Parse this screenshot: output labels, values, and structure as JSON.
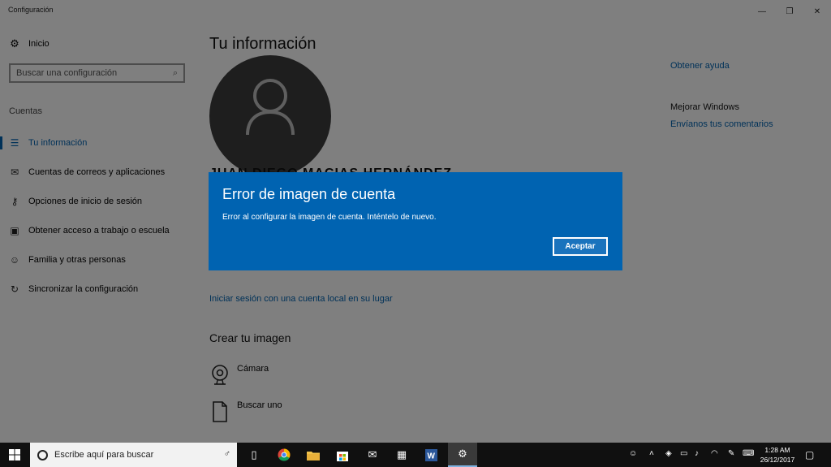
{
  "window": {
    "title": "Configuración"
  },
  "sidebar": {
    "home_label": "Inicio",
    "search_placeholder": "Buscar una configuración",
    "section_label": "Cuentas",
    "items": [
      {
        "label": "Tu información",
        "icon": "contact-card-icon",
        "active": true
      },
      {
        "label": "Cuentas de correos y aplicaciones",
        "icon": "mail-icon"
      },
      {
        "label": "Opciones de inicio de sesión",
        "icon": "key-icon"
      },
      {
        "label": "Obtener acceso a trabajo o escuela",
        "icon": "briefcase-icon"
      },
      {
        "label": "Familia y otras personas",
        "icon": "person-icon"
      },
      {
        "label": "Sincronizar la configuración",
        "icon": "sync-icon"
      }
    ]
  },
  "main": {
    "title": "Tu información",
    "user_name": "JUAN DIEGO MACIAS HERNÁNDEZ",
    "local_account_link": "Iniciar sesión con una cuenta local en su lugar",
    "create_title": "Crear tu imagen",
    "create_items": [
      {
        "label": "Cámara",
        "icon": "camera-icon"
      },
      {
        "label": "Buscar uno",
        "icon": "browse-file-icon"
      }
    ]
  },
  "right": {
    "help_link": "Obtener ayuda",
    "improve_title": "Mejorar Windows",
    "feedback_link": "Envíanos tus comentarios"
  },
  "dialog": {
    "title": "Error de imagen de cuenta",
    "message": "Error al configurar la imagen de cuenta. Inténtelo de nuevo.",
    "button": "Aceptar",
    "color": "#0063b1"
  },
  "taskbar": {
    "search_placeholder": "Escribe aquí para buscar",
    "time": "1:28 AM",
    "date": "26/12/2017"
  },
  "colors": {
    "accent": "#0063b1",
    "taskbar": "#101010"
  }
}
